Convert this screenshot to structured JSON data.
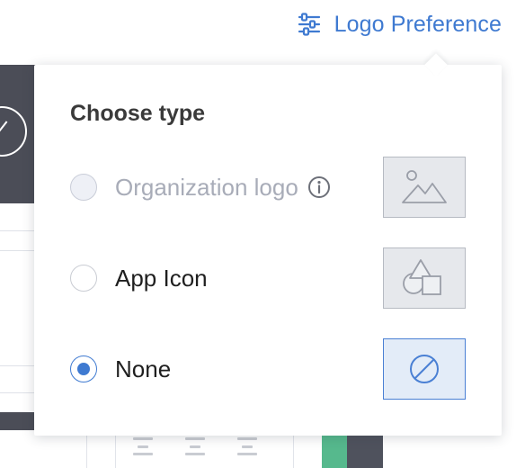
{
  "trigger": {
    "label": "Logo Preference",
    "icon": "sliders-icon",
    "accent_color": "#3f7ad1"
  },
  "popover": {
    "title": "Choose type",
    "options": [
      {
        "label": "Organization logo",
        "state": "disabled",
        "info_icon": "info-icon",
        "thumbnail_icon": "image-icon"
      },
      {
        "label": "App Icon",
        "state": "unchecked",
        "thumbnail_icon": "shapes-icon"
      },
      {
        "label": "None",
        "state": "checked",
        "thumbnail_icon": "no-symbol-icon"
      }
    ]
  }
}
